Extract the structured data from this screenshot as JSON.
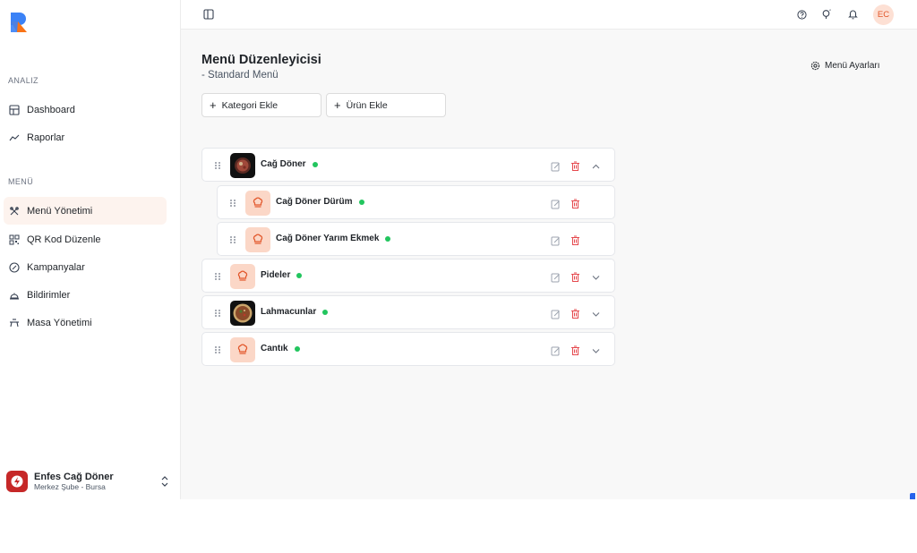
{
  "sidebar": {
    "section_analiz": "ANALIZ",
    "section_menu": "MENÜ",
    "items": [
      {
        "label": "Dashboard"
      },
      {
        "label": "Raporlar"
      },
      {
        "label": "Menü Yönetimi"
      },
      {
        "label": "QR Kod Düzenle"
      },
      {
        "label": "Kampanyalar"
      },
      {
        "label": "Bildirimler"
      },
      {
        "label": "Masa Yönetimi"
      }
    ],
    "business": {
      "name": "Enfes Cağ Döner",
      "branch": "Merkez Şube - Bursa"
    }
  },
  "topbar": {
    "avatar_initials": "EC"
  },
  "page": {
    "title": "Menü Düzenleyicisi",
    "subtitle": "- Standard Menü",
    "settings_label": "Menü Ayarları",
    "add_category": "Kategori Ekle",
    "add_product": "Ürün Ekle"
  },
  "menu": {
    "categories": [
      {
        "name": "Cağ Döner",
        "active": true,
        "image": "photo",
        "expanded": true
      },
      {
        "name": "Pideler",
        "active": true,
        "image": "chef-hat-icon",
        "expanded": false
      },
      {
        "name": "Lahmacunlar",
        "active": true,
        "image": "photo",
        "expanded": false
      },
      {
        "name": "Cantık",
        "active": true,
        "image": "chef-hat-icon",
        "expanded": false
      }
    ],
    "products": [
      {
        "name": "Cağ Döner Dürüm",
        "active": true,
        "image": "chef-hat-icon"
      },
      {
        "name": "Cağ Döner Yarım Ekmek",
        "active": true,
        "image": "chef-hat-icon"
      }
    ]
  },
  "colors": {
    "accent": "#e2572b",
    "status_active": "#22c55e",
    "delete": "#e5484d"
  }
}
